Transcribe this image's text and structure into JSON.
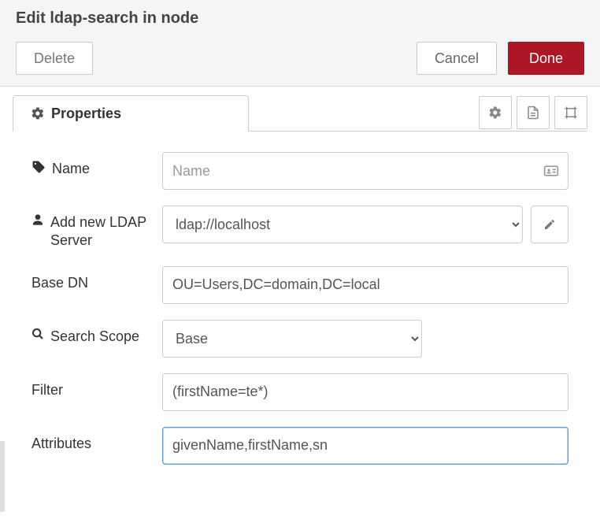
{
  "header": {
    "title": "Edit ldap-search in node",
    "delete": "Delete",
    "cancel": "Cancel",
    "done": "Done"
  },
  "tabs": {
    "properties": "Properties"
  },
  "form": {
    "name": {
      "label": "Name",
      "placeholder": "Name",
      "value": ""
    },
    "server": {
      "label": "Add new LDAP Server",
      "selected": "ldap://localhost"
    },
    "basedn": {
      "label": "Base DN",
      "value": "OU=Users,DC=domain,DC=local"
    },
    "scope": {
      "label": "Search Scope",
      "selected": "Base"
    },
    "filter": {
      "label": "Filter",
      "value": "(firstName=te*)"
    },
    "attributes": {
      "label": "Attributes",
      "value": "givenName,firstName,sn"
    }
  }
}
